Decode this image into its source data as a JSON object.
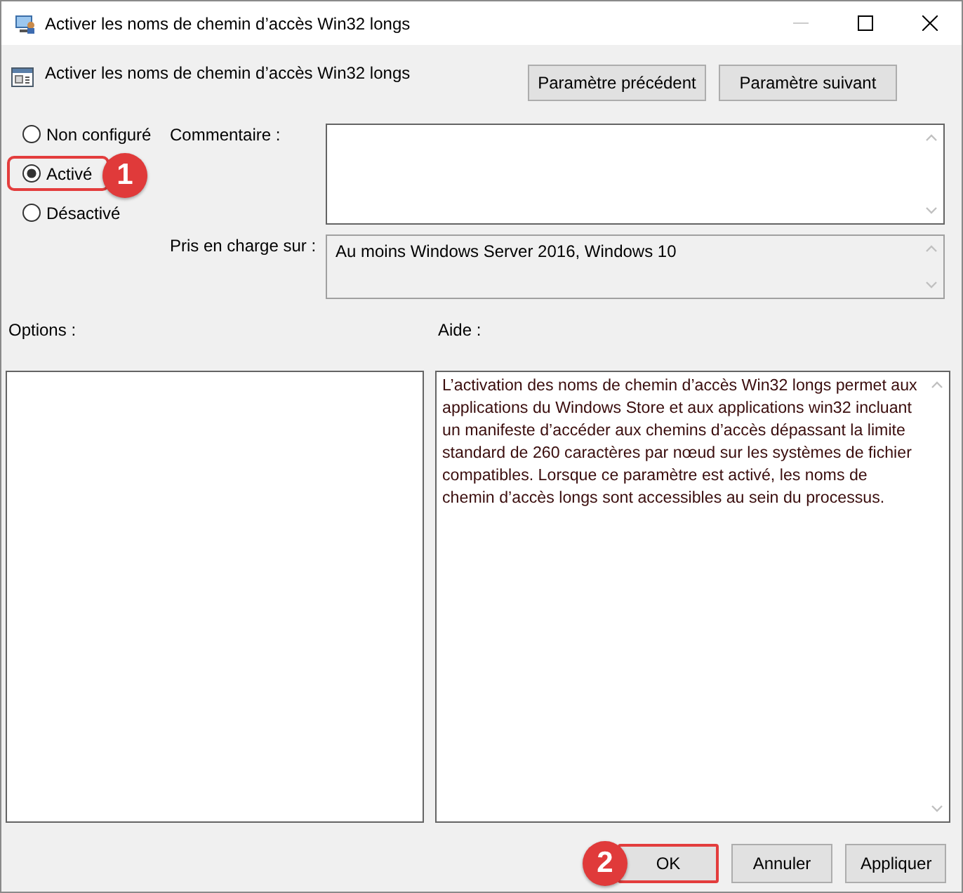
{
  "window": {
    "title": "Activer les noms de chemin d’accès Win32 longs"
  },
  "header": {
    "title": "Activer les noms de chemin d’accès Win32 longs",
    "buttons": [
      {
        "label": "Paramètre précédent"
      },
      {
        "label": "Paramètre suivant"
      }
    ]
  },
  "states": [
    {
      "label": "Non configuré",
      "selected": false,
      "highlighted": false
    },
    {
      "label": "Activé",
      "selected": true,
      "highlighted": true,
      "badge": "1"
    },
    {
      "label": "Désactivé",
      "selected": false,
      "highlighted": false
    }
  ],
  "comment": {
    "label": "Commentaire :"
  },
  "supported_on": {
    "label": "Pris en charge sur :",
    "value": "Au moins Windows Server 2016, Windows 10"
  },
  "options": {
    "label": "Options :"
  },
  "help": {
    "label": "Aide :",
    "text": "L’activation des noms de chemin d’accès Win32 longs permet aux applications du Windows Store et aux applications win32 incluant un manifeste d’accéder aux chemins d’accès dépassant la limite standard de 260 caractères par nœud sur les systèmes de fichier compatibles. Lorsque ce paramètre est activé, les noms de chemin d’accès longs sont accessibles au sein du processus."
  },
  "buttons": [
    {
      "label": "OK",
      "highlighted": true,
      "badge": "2"
    },
    {
      "label": "Annuler",
      "highlighted": false
    },
    {
      "label": "Appliquer",
      "highlighted": false
    }
  ]
}
